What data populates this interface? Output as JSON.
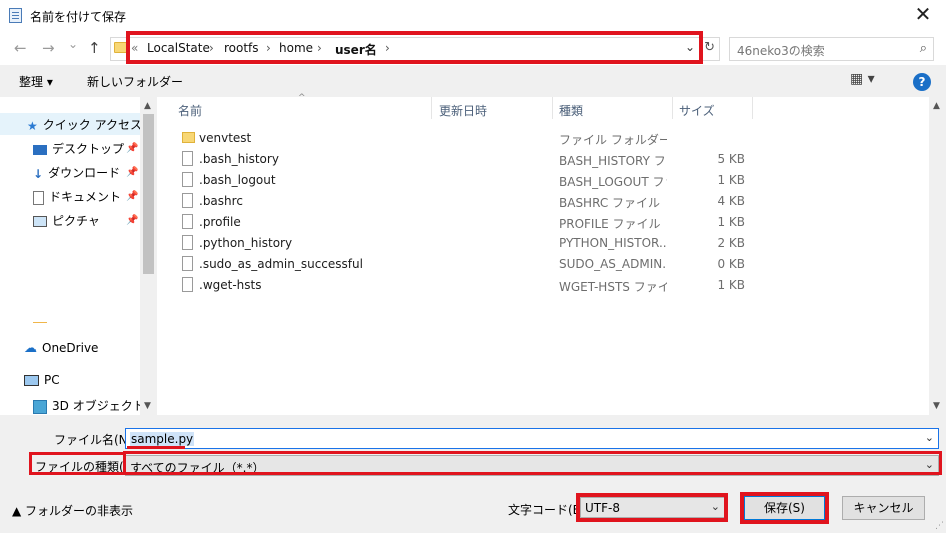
{
  "window": {
    "title": "名前を付けて保存",
    "close_glyph": "✕"
  },
  "nav": {
    "back": "←",
    "forward": "→",
    "recent": "⌄",
    "up": "↑",
    "address": {
      "overflow": "«",
      "crumbs": [
        "LocalState",
        "rootfs",
        "home",
        "user名"
      ],
      "separator": "›",
      "dropdown": "⌄",
      "refresh": "↻"
    },
    "search": {
      "placeholder": "46neko3の検索",
      "icon": "search-icon"
    }
  },
  "toolbar": {
    "organize": "整理 ▾",
    "new_folder": "新しいフォルダー",
    "view": "▦ ▾",
    "help": "?"
  },
  "sidebar": {
    "quick_access": "クイック アクセス",
    "items": [
      {
        "label": "デスクトップ",
        "icon": "desktop-icon"
      },
      {
        "label": "ダウンロード",
        "icon": "download-icon"
      },
      {
        "label": "ドキュメント",
        "icon": "documents-icon"
      },
      {
        "label": "ピクチャ",
        "icon": "pictures-icon"
      }
    ],
    "onedrive": "OneDrive",
    "pc": "PC",
    "objects3d": "3D オブジェクト"
  },
  "columns": {
    "name": "名前",
    "date": "更新日時",
    "type": "種類",
    "size": "サイズ",
    "sort": "^"
  },
  "files": [
    {
      "name": "venvtest",
      "type": "ファイル フォルダー",
      "size": "",
      "folder": true
    },
    {
      "name": ".bash_history",
      "type": "BASH_HISTORY ファ...",
      "size": "5 KB"
    },
    {
      "name": ".bash_logout",
      "type": "BASH_LOGOUT ファ...",
      "size": "1 KB"
    },
    {
      "name": ".bashrc",
      "type": "BASHRC ファイル",
      "size": "4 KB"
    },
    {
      "name": ".profile",
      "type": "PROFILE ファイル",
      "size": "1 KB"
    },
    {
      "name": ".python_history",
      "type": "PYTHON_HISTOR...",
      "size": "2 KB"
    },
    {
      "name": ".sudo_as_admin_successful",
      "type": "SUDO_AS_ADMIN...",
      "size": "0 KB"
    },
    {
      "name": ".wget-hsts",
      "type": "WGET-HSTS ファイル",
      "size": "1 KB"
    }
  ],
  "form": {
    "filename_label": "ファイル名(N):",
    "filename_value": "sample.py",
    "filetype_label": "ファイルの種類(T):",
    "filetype_value": "すべてのファイル（*.*）",
    "encoding_label": "文字コード(E):",
    "encoding_value": "UTF-8",
    "hide_folders": "▲  フォルダーの非表示",
    "save": "保存(S)",
    "cancel": "キャンセル",
    "dropdown": "⌄"
  },
  "colors": {
    "highlight": "#e0141e",
    "selection": "#e5f3fb",
    "accent": "#0078d7"
  }
}
